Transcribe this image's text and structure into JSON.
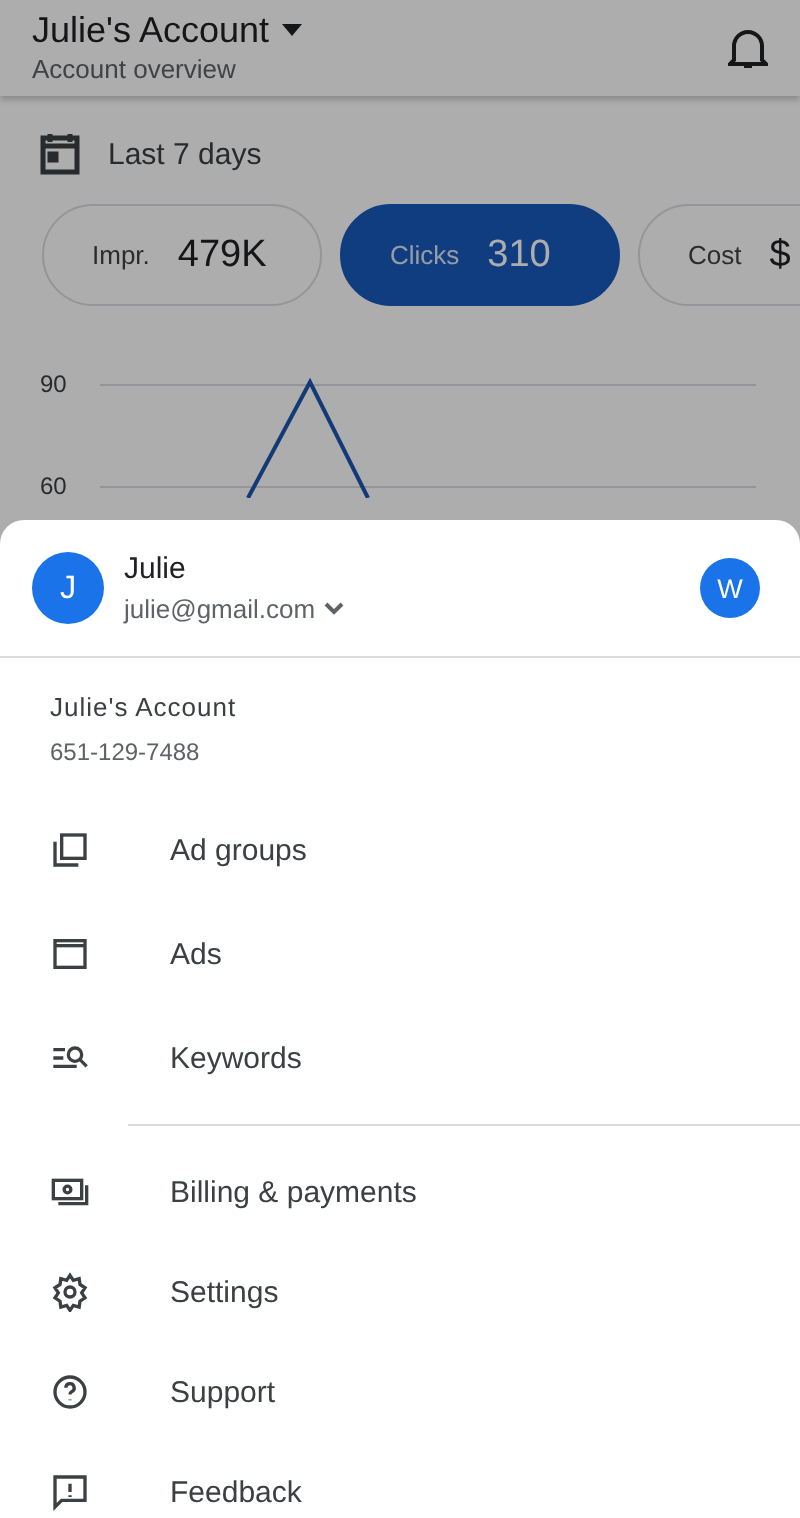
{
  "app_bar": {
    "title": "Julie's Account",
    "subtitle": "Account overview"
  },
  "date_range": "Last 7 days",
  "metrics": [
    {
      "label": "Impr.",
      "value": "479K",
      "selected": false
    },
    {
      "label": "Clicks",
      "value": "310",
      "selected": true
    },
    {
      "label": "Cost",
      "value": "$",
      "selected": false
    }
  ],
  "chart_ticks": [
    "90",
    "60"
  ],
  "account_sheet": {
    "user": {
      "initial": "J",
      "name": "Julie",
      "email": "julie@gmail.com",
      "switch_initial": "W"
    },
    "account": {
      "name": "Julie's Account",
      "id": "651-129-7488"
    },
    "menu_groups": [
      [
        "Ad groups",
        "Ads",
        "Keywords"
      ],
      [
        "Billing & payments",
        "Settings",
        "Support",
        "Feedback"
      ]
    ]
  }
}
